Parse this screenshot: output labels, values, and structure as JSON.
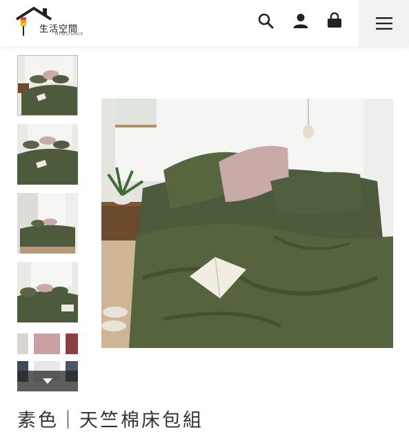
{
  "header": {
    "logo_name": "生活空間",
    "logo_sub": "MYSELFSPACE",
    "icons": [
      "search-icon",
      "user-icon",
      "shopping-bag-icon",
      "hamburger-menu-icon"
    ]
  },
  "gallery": {
    "thumbnails": [
      {
        "label": "thumbnail-1",
        "active": true
      },
      {
        "label": "thumbnail-2",
        "active": false
      },
      {
        "label": "thumbnail-3",
        "active": false
      },
      {
        "label": "thumbnail-4",
        "active": false
      },
      {
        "label": "thumbnail-5",
        "active": false
      }
    ],
    "more_icon": "chevron-down-icon"
  },
  "product": {
    "title": "素色｜天竺棉床包組"
  },
  "colors": {
    "olive": "#4d5a3b",
    "pink": "#c9aaa8",
    "wood": "#6b4a2e",
    "wall": "#ebe9e5"
  }
}
